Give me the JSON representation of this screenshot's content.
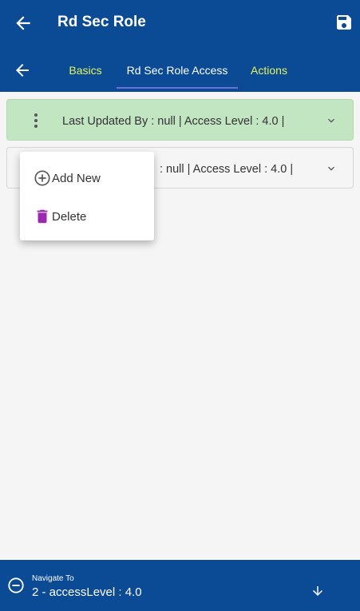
{
  "app_bar": {
    "title": "Rd Sec Role",
    "back_icon": "arrow-left-icon",
    "save_icon": "save-icon"
  },
  "tabs": {
    "back_icon": "arrow-left-icon",
    "items": [
      {
        "label": "Basics"
      },
      {
        "label": "Rd Sec Role Access"
      },
      {
        "label": "Actions"
      }
    ],
    "active_index": 1
  },
  "list": {
    "items": [
      {
        "text": "Last Updated By  : null | Access Level  : 4.0 |",
        "selected": true
      },
      {
        "text": ": null | Access Level  : 4.0 |",
        "selected": false
      }
    ]
  },
  "context_menu": {
    "items": [
      {
        "label": "Add New",
        "icon": "plus-circle-icon"
      },
      {
        "label": "Delete",
        "icon": "trash-icon"
      }
    ]
  },
  "bottom_bar": {
    "label": "Navigate To",
    "value": "2 - accessLevel : 4.0"
  },
  "colors": {
    "primary": "#0b4a95",
    "tab_accent": "#e6f45b",
    "selected_row": "#c2e5c2",
    "delete_icon": "#9c27b0"
  }
}
